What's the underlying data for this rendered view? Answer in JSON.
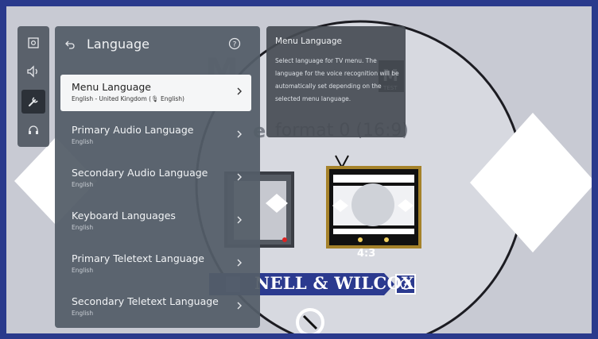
{
  "rail": {
    "icons": [
      "picture-icon",
      "sound-icon",
      "settings-wrench-icon",
      "support-headset-icon"
    ],
    "active_index": 2
  },
  "panel": {
    "title": "Language",
    "items": [
      {
        "label": "Menu Language",
        "value": "English - United Kingdom (🎙 English)",
        "selected": true
      },
      {
        "label": "Primary Audio Language",
        "value": "English"
      },
      {
        "label": "Secondary Audio Language",
        "value": "English"
      },
      {
        "label": "Keyboard Languages",
        "value": "English"
      },
      {
        "label": "Primary Teletext Language",
        "value": "English"
      },
      {
        "label": "Secondary Teletext Language",
        "value": "English"
      }
    ]
  },
  "tooltip": {
    "title": "Menu Language",
    "body": "Select language for TV menu. The language for the voice recognition will be automatically set depending on the selected menu language."
  },
  "test_pattern": {
    "brand_text": "NELL & WILCOX",
    "aspect_label": "4:3"
  },
  "colors": {
    "background": "#c8cad3",
    "frame": "#2a3a8c",
    "panel": "#545e68",
    "selected_item": "#f5f6f7",
    "tv_frame": "#a5822a",
    "brand_band": "#2b3a8f"
  }
}
